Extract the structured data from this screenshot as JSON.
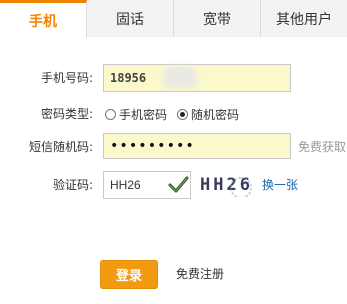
{
  "tabs": [
    {
      "label": "手机",
      "active": true
    },
    {
      "label": "固话",
      "active": false
    },
    {
      "label": "宽带",
      "active": false
    },
    {
      "label": "其他用户",
      "active": false
    }
  ],
  "form": {
    "phone": {
      "label": "手机号码:",
      "value": "18956"
    },
    "password_type": {
      "label": "密码类型:",
      "options": [
        {
          "label": "手机密码",
          "checked": false
        },
        {
          "label": "随机密码",
          "checked": true
        }
      ]
    },
    "sms_code": {
      "label": "短信随机码:",
      "value": "•••••••••",
      "action": "免费获取"
    },
    "captcha": {
      "label": "验证码:",
      "value": "HH26",
      "image_text": "HH26",
      "refresh": "换一张"
    }
  },
  "actions": {
    "login": "登录",
    "register": "免费注册"
  },
  "colors": {
    "accent": "#f08300",
    "button": "#f29a10",
    "input_fill": "#fbf8cc",
    "link": "#1a66b3"
  },
  "icons": {
    "captcha_valid": "check-icon"
  }
}
